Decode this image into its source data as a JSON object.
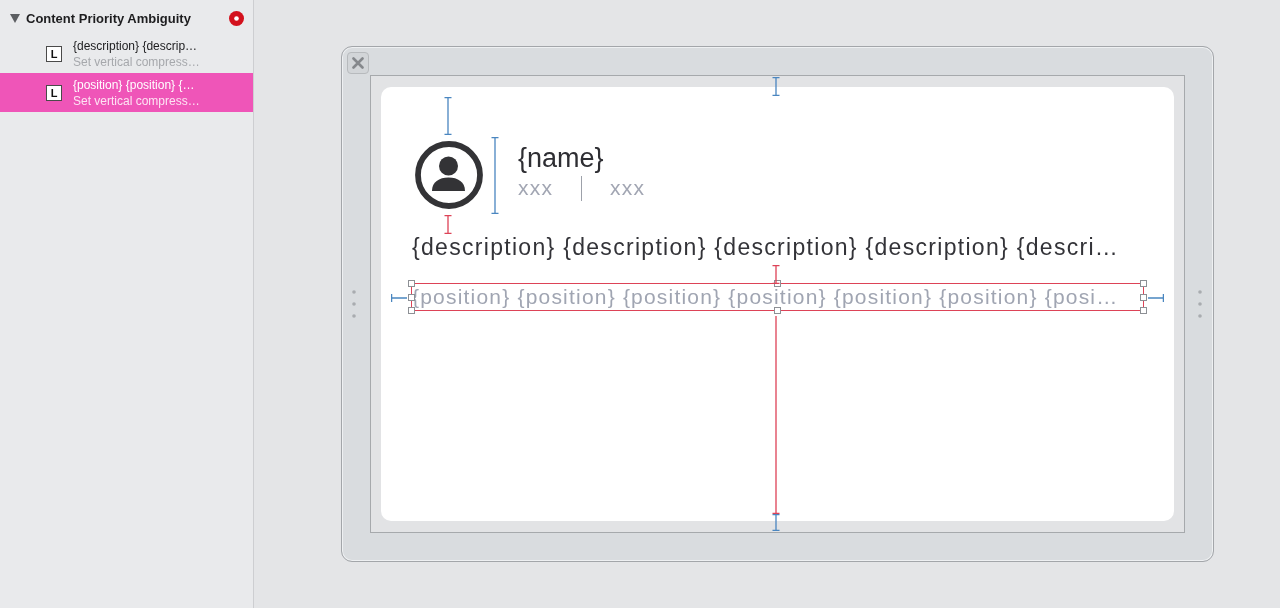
{
  "sidebar": {
    "group": {
      "title": "Content Priority Ambiguity",
      "expanded": true,
      "items": [
        {
          "badge": "L",
          "title": "{description} {descrip…",
          "subtitle": "Set vertical compress…",
          "selected": false
        },
        {
          "badge": "L",
          "title": "{position} {position} {…",
          "subtitle": "Set vertical compress…",
          "selected": true
        }
      ]
    }
  },
  "scene": {
    "card": {
      "name": "{name}",
      "meta": [
        "xxx",
        "xxx"
      ],
      "labels": [
        {
          "kind": "description",
          "text": "{description} {description} {description} {description} {descri…",
          "selected": false
        },
        {
          "kind": "position",
          "text": "{position} {position} {position} {position} {position} {position} {posi…",
          "selected": true
        }
      ]
    }
  }
}
